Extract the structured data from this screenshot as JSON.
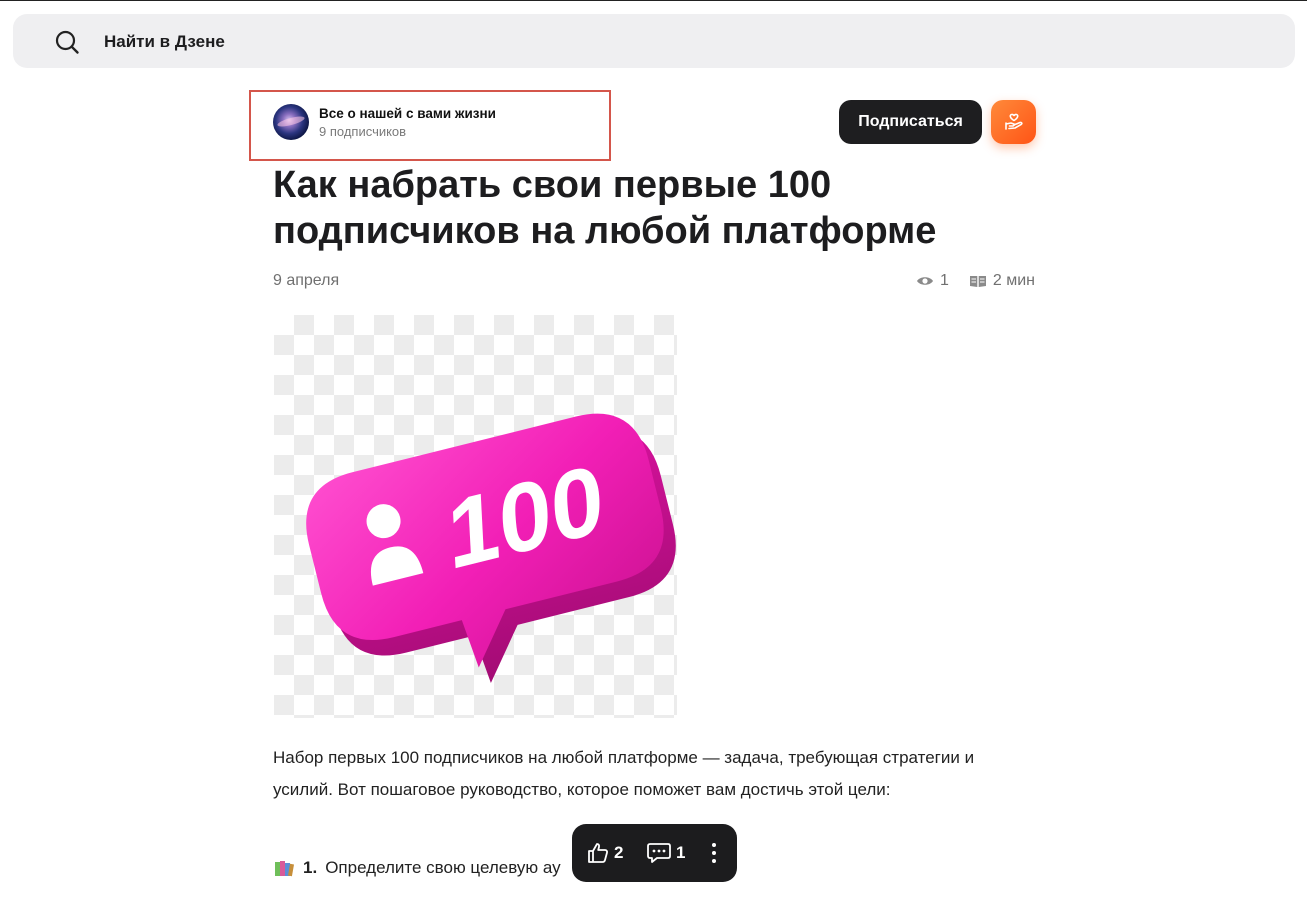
{
  "search": {
    "placeholder": "Найти в Дзене",
    "icon": "search-icon"
  },
  "channel": {
    "name": "Все о нашей с вами жизни",
    "subscribers": "9 подписчиков",
    "highlight_color": "#d4564b"
  },
  "header": {
    "subscribe_label": "Подписаться",
    "donate_icon": "donate-hand-heart-icon",
    "donate_color": "#ff6a20"
  },
  "article": {
    "title": "Как набрать свои первые 100 подписчиков на любой платформе",
    "date": "9 апреля",
    "views": "1",
    "read_time": "2 мин",
    "image": {
      "badge_number": "100",
      "badge_color": "#f21fb6"
    },
    "intro": "Набор первых 100 подписчиков на любой платформе — задача, требующая стратегии и усилий. Вот пошаговое руководство, которое поможет вам достичь этой цели:",
    "list_item_number": "1.",
    "list_item_text": "Определите свою целевую ау"
  },
  "actions": {
    "likes": "2",
    "comments": "1",
    "like_icon": "thumbs-up-icon",
    "comment_icon": "comment-icon",
    "more_icon": "more-vertical-icon"
  }
}
